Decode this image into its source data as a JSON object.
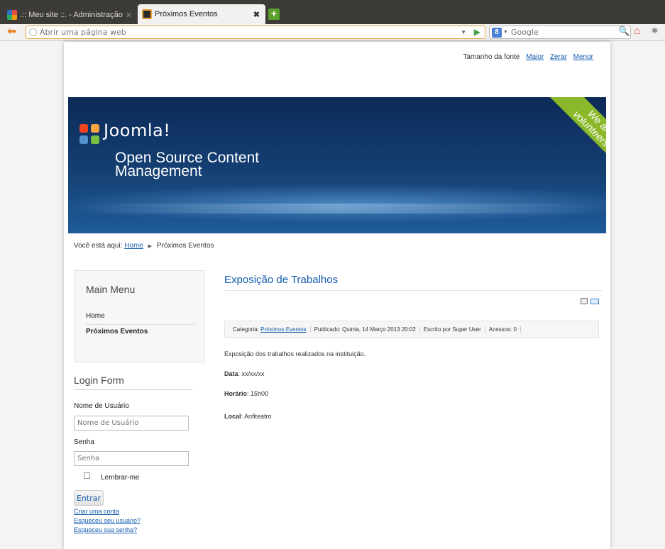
{
  "browser": {
    "tabs": [
      {
        "title": ".:: Meu site ::. - Administração",
        "close": "✕"
      },
      {
        "title": "Próximos Eventos",
        "close": "✖"
      }
    ],
    "address_placeholder": "Abrir uma página web",
    "search_placeholder": "Google",
    "search_engine_glyph": "8"
  },
  "page": {
    "font_size": {
      "label": "Tamanho da fonte",
      "bigger": "Maior",
      "reset": "Zerar",
      "smaller": "Menor"
    },
    "header": {
      "logo": "Joomla!",
      "tagline": "Open Source Content\nManagement",
      "ribbon": "We are\nvolunteers !"
    },
    "breadcrumb": {
      "prefix": "Você está aqui:",
      "home": "Home",
      "current": "Próximos Eventos"
    },
    "main_menu": {
      "title": "Main Menu",
      "items": [
        "Home",
        "Próximos Eventos"
      ],
      "active_index": 1
    },
    "login": {
      "title": "Login Form",
      "username_label": "Nome de Usuário",
      "username_placeholder": "Nome de Usuário",
      "password_label": "Senha",
      "password_placeholder": "Senha",
      "remember_label": "Lembrar-me",
      "submit": "Entrar",
      "links": [
        "Criar uma conta",
        "Esqueceu seu usuário?",
        "Esqueceu sua senha?"
      ]
    },
    "article": {
      "title": "Exposição de Trabalhos",
      "info": {
        "category_prefix": "Categoria:",
        "category": "Próximos Eventos",
        "published": "Publicado: Quinta, 14 Março 2013 20:02",
        "author": "Escrito por Super User",
        "hits": "Acessos: 0"
      },
      "body": "Exposição dos trabalhos realizados na instituição.",
      "fields": [
        {
          "label": "Data",
          "value": ": xx/xx/xx"
        },
        {
          "label": "Horário",
          "value": ": 15h00"
        },
        {
          "label": "Local",
          "value": ": Anfiteatro"
        }
      ]
    }
  },
  "colors": {
    "link": "#135cae",
    "header_bg": "#154073",
    "ribbon": "#8bb82a",
    "tab_bar": "#3c3b37"
  }
}
